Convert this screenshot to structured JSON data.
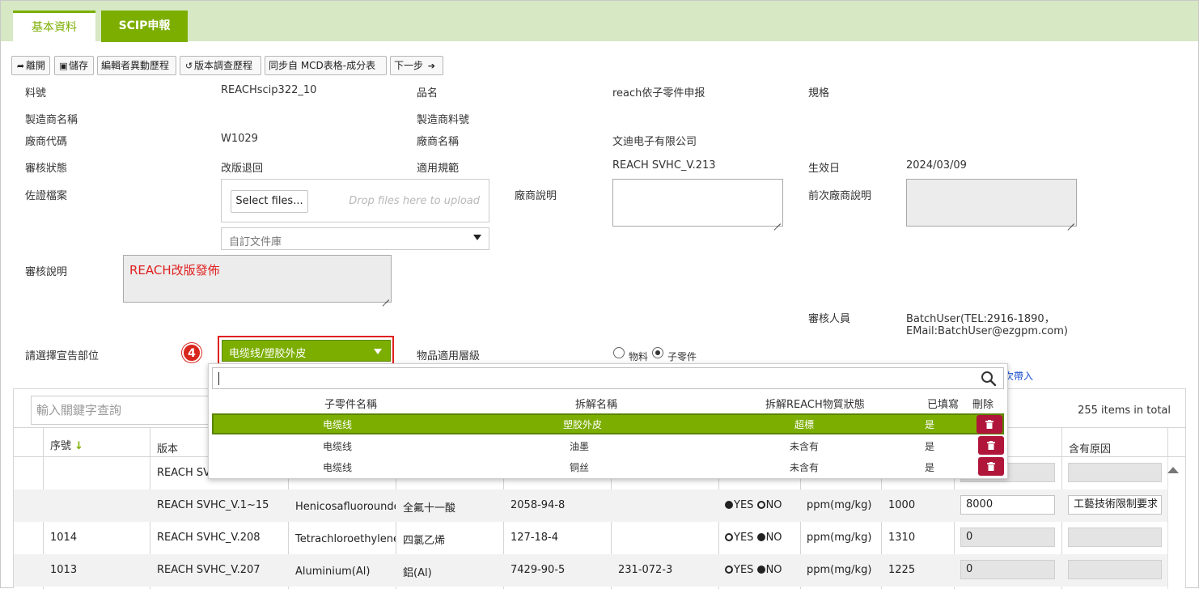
{
  "tabs": {
    "basic": "基本資料",
    "scip": "SCIP申報"
  },
  "toolbar": {
    "leave": "離開",
    "save": "儲存",
    "editor_history": "編輯者異動歷程",
    "version_history": "版本調查歷程",
    "sync_mcd": "同步自 MCD表格-成分表",
    "next": "下一步"
  },
  "form": {
    "part_no_label": "料號",
    "part_no": "REACHscip322_10",
    "product_name_label": "品名",
    "product_name": "reach依子零件申报",
    "spec_label": "規格",
    "mfr_name_label": "製造商名稱",
    "mfr_part_label": "製造商料號",
    "vendor_code_label": "廠商代碼",
    "vendor_code": "W1029",
    "vendor_name_label": "廠商名稱",
    "vendor_name": "文迪电子有限公司",
    "review_status_label": "審核狀態",
    "review_status": "改版退回",
    "regulation_label": "適用規範",
    "regulation": "REACH SVHC_V.213",
    "effective_label": "生效日",
    "effective": "2024/03/09",
    "evidence_label": "佐證檔案",
    "select_files": "Select files...",
    "drop_hint": "Drop files here to upload",
    "library_placeholder": "自訂文件庫",
    "vendor_note_label": "廠商說明",
    "prev_vendor_note_label": "前次廠商說明",
    "review_note_label": "審核說明",
    "review_note": "REACH改版發佈",
    "reviewer_label": "審核人員",
    "reviewer_line1": "BatchUser(TEL:2916-1890，",
    "reviewer_line2": "EMail:BatchUser@ezgpm.com)",
    "declare_part_label": "請選擇宣告部位",
    "declare_part_value": "电缆线/塑胶外皮",
    "step_badge": "4",
    "level_label": "物品適用層級",
    "level_material": "物料",
    "level_subpart": "子零件",
    "bring_link": "次帶入"
  },
  "grid": {
    "search_placeholder": "輸入關鍵字查詢",
    "total": "255 items in total",
    "headers": {
      "seq": "序號",
      "version": "版本",
      "reason": "含有原因"
    },
    "rows": [
      {
        "seq": "",
        "version": "REACH SV",
        "name": "",
        "cn": "",
        "cas": "",
        "ec": "",
        "yes": false,
        "unit": "",
        "limit": "",
        "value": "",
        "reason": ""
      },
      {
        "seq": "",
        "version": "REACH SVHC_V.1~15",
        "name": "Henicosafluoroundec",
        "cn": "全氟十一酸",
        "cas": "2058-94-8",
        "ec": "",
        "yes": true,
        "unit": "ppm(mg/kg)",
        "limit": "1000",
        "value": "8000",
        "reason": "工藝技術限制要求"
      },
      {
        "seq": "1014",
        "version": "REACH SVHC_V.208",
        "name": "Tetrachloroethylene",
        "cn": "四氯乙烯",
        "cas": "127-18-4",
        "ec": "",
        "yes": false,
        "unit": "ppm(mg/kg)",
        "limit": "1310",
        "value": "0",
        "reason": ""
      },
      {
        "seq": "1013",
        "version": "REACH SVHC_V.207",
        "name": "Aluminium(Al)",
        "cn": "鋁(Al)",
        "cas": "7429-90-5",
        "ec": "231-072-3",
        "yes": false,
        "unit": "ppm(mg/kg)",
        "limit": "1225",
        "value": "0",
        "reason": ""
      }
    ],
    "yes_label": "YES",
    "no_label": "NO"
  },
  "popup": {
    "headers": {
      "subpart": "子零件名稱",
      "breakdown": "拆解名稱",
      "status": "拆解REACH物質狀態",
      "filled": "已填寫",
      "delete": "刪除"
    },
    "rows": [
      {
        "subpart": "电缆线",
        "breakdown": "塑胶外皮",
        "status": "超標",
        "filled": "是"
      },
      {
        "subpart": "电缆线",
        "breakdown": "油墨",
        "status": "未含有",
        "filled": "是"
      },
      {
        "subpart": "电缆线",
        "breakdown": "铜丝",
        "status": "未含有",
        "filled": "是"
      }
    ]
  },
  "colors": {
    "accent": "#7cae00",
    "tab_bar": "#d6e8c4",
    "delete": "#b0163a",
    "highlight": "#e02020"
  }
}
